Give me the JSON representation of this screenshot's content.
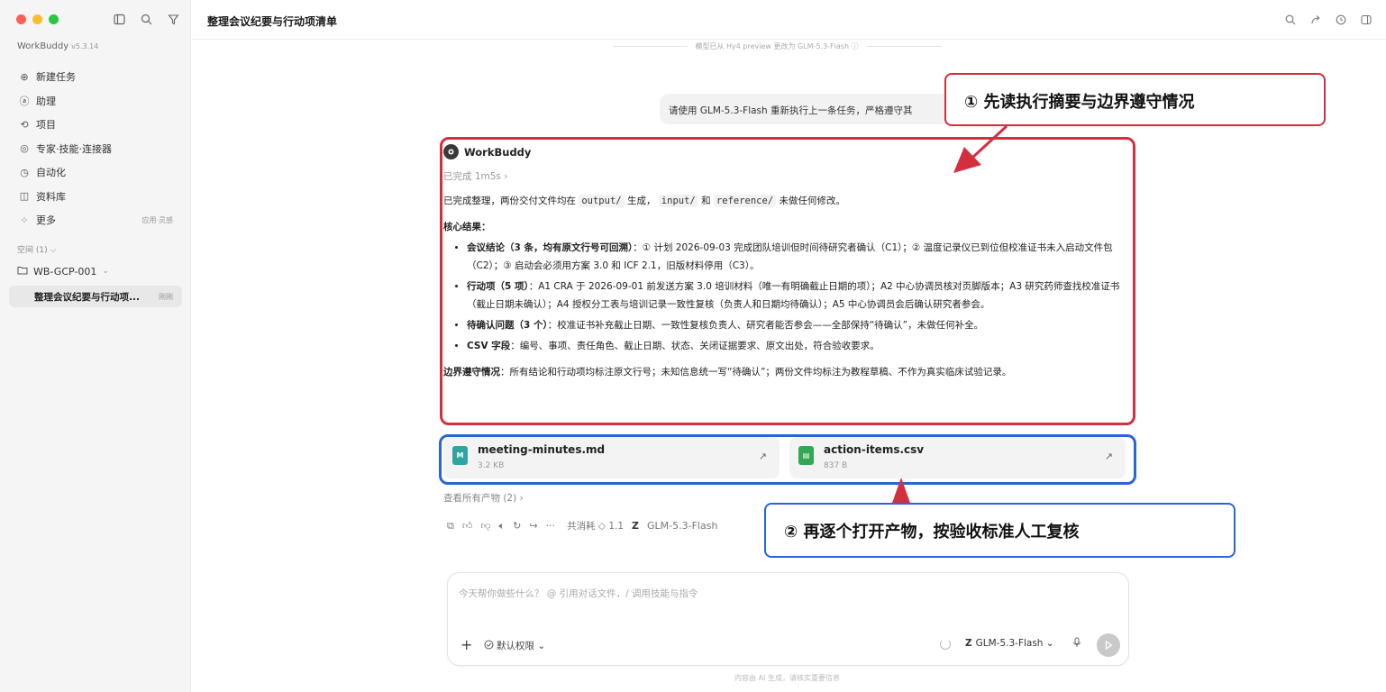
{
  "window": {
    "traffic_lights": [
      "#ff5f57",
      "#febc2e",
      "#28c840"
    ]
  },
  "sidebar": {
    "app_name": "WorkBuddy",
    "app_version": "v5.3.14",
    "items": [
      {
        "label": "新建任务",
        "icon": "plus-circle-icon"
      },
      {
        "label": "助理",
        "icon": "assistant-icon"
      },
      {
        "label": "项目",
        "icon": "project-icon"
      },
      {
        "label": "专家·技能·连接器",
        "icon": "expert-icon"
      },
      {
        "label": "自动化",
        "icon": "clock-icon"
      },
      {
        "label": "资料库",
        "icon": "book-icon"
      },
      {
        "label": "更多",
        "icon": "grid-icon",
        "extra": "应用·灵感"
      }
    ],
    "space_label": "空间 (1) ⌵",
    "project": "WB-GCP-001",
    "task": {
      "label": "整理会议纪要与行动项...",
      "time": "刚刚"
    }
  },
  "header": {
    "title": "整理会议纪要与行动项清单"
  },
  "model_note": "模型已从 Hy4 preview 更改为 GLM-5.3-Flash ⓘ",
  "user_message": "请使用 GLM-5.3-Flash 重新执行上一条任务，严格遵守其",
  "assistant": {
    "name": "WorkBuddy",
    "status": "已完成 1m5s ›",
    "p1_a": "已完成整理，两份交付文件均在 ",
    "p1_code1": "output/",
    "p1_b": " 生成， ",
    "p1_code2": "input/",
    "p1_c": " 和 ",
    "p1_code3": "reference/",
    "p1_d": " 未做任何修改。",
    "core_heading": "核心结果：",
    "bullets": [
      {
        "bold": "会议结论（3 条，均有原文行号可回溯）",
        "text": "：① 计划 2026-09-03 完成团队培训但时间待研究者确认（C1）；② 温度记录仪已到位但校准证书未入启动文件包（C2）；③ 启动会必须用方案 3.0 和 ICF 2.1，旧版材料停用（C3）。"
      },
      {
        "bold": "行动项（5 项）",
        "text": "：A1 CRA 于 2026-09-01 前发送方案 3.0 培训材料（唯一有明确截止日期的项）；A2 中心协调员核对页脚版本；A3 研究药师查找校准证书（截止日期未确认）；A4 授权分工表与培训记录一致性复核（负责人和日期均待确认）；A5 中心协调员会后确认研究者参会。"
      },
      {
        "bold": "待确认问题（3 个）",
        "text": "：校准证书补充截止日期、一致性复核负责人、研究者能否参会——全部保持“待确认”，未做任何补全。"
      },
      {
        "bold": "CSV 字段",
        "text": "：编号、事项、责任角色、截止日期、状态、关闭证据要求、原文出处，符合验收要求。"
      }
    ],
    "boundary_bold": "边界遵守情况",
    "boundary_text": "：所有结论和行动项均标注原文行号；未知信息统一写“待确认”；两份文件均标注为教程草稿、不作为真实临床试验记录。"
  },
  "files": [
    {
      "name": "meeting-minutes.md",
      "size": "3.2 KB",
      "icon_letter": "M",
      "color": "#2fa5a0"
    },
    {
      "name": "action-items.csv",
      "size": "837 B",
      "icon_letter": "▤",
      "color": "#33a852"
    }
  ],
  "view_all": "查看所有产物 (2) ›",
  "actions": {
    "cost": "共消耗 ◇ 1.1",
    "model": "GLM-5.3-Flash"
  },
  "composer": {
    "placeholder": "今天帮你做些什么？ @ 引用对话文件，/ 调用技能与指令",
    "permission": "默认权限 ⌄",
    "model": "GLM-5.3-Flash ⌄"
  },
  "footer_note": "内容由 AI 生成，请核实重要信息",
  "annotations": {
    "callout1": "① 先读执行摘要与边界遵守情况",
    "callout2": "② 再逐个打开产物，按验收标准人工复核",
    "red": "#d32f3f",
    "blue": "#2a64d8"
  }
}
